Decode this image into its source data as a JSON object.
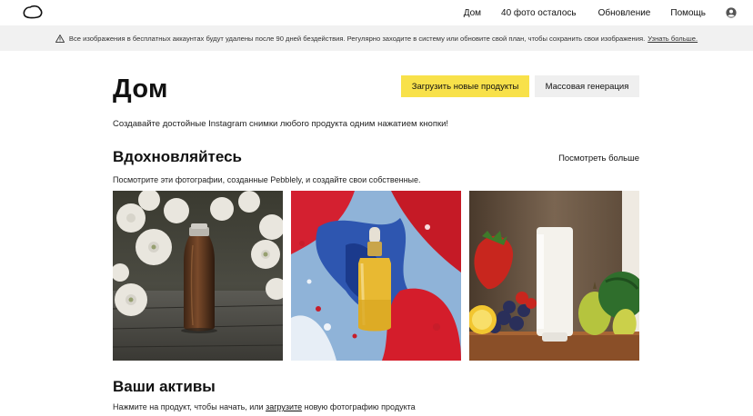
{
  "nav": {
    "home": "Дом",
    "photos_left": "40 фото осталось",
    "upgrade": "Обновление",
    "help": "Помощь"
  },
  "banner": {
    "message": "Все изображения в бесплатных аккаунтах будут удалены после 90 дней бездействия. Регулярно заходите в систему или обновите свой план, чтобы сохранить свои изображения.",
    "link": "Узнать больше."
  },
  "header": {
    "title": "Дом",
    "upload_button": "Загрузить новые продукты",
    "bulk_button": "Массовая генерация",
    "subtitle": "Создавайте достойные Instagram снимки любого продукта одним нажатием кнопки!"
  },
  "inspire": {
    "title": "Вдохновляйтесь",
    "see_more": "Посмотреть больше",
    "description": "Посмотрите эти фотографии, созданные Pebblely, и создайте свои собственные."
  },
  "assets": {
    "title": "Ваши активы",
    "desc_before": "Нажмите на продукт, чтобы начать, или",
    "desc_link": "загрузите",
    "desc_after": "новую фотографию продукта"
  },
  "colors": {
    "accent_yellow": "#f8e14a",
    "banner_bg": "#f1f1f1",
    "secondary_button": "#efefef"
  },
  "icons": {
    "logo": "pebble-logo-icon",
    "user": "user-circle-icon",
    "warning": "warning-triangle-icon"
  }
}
